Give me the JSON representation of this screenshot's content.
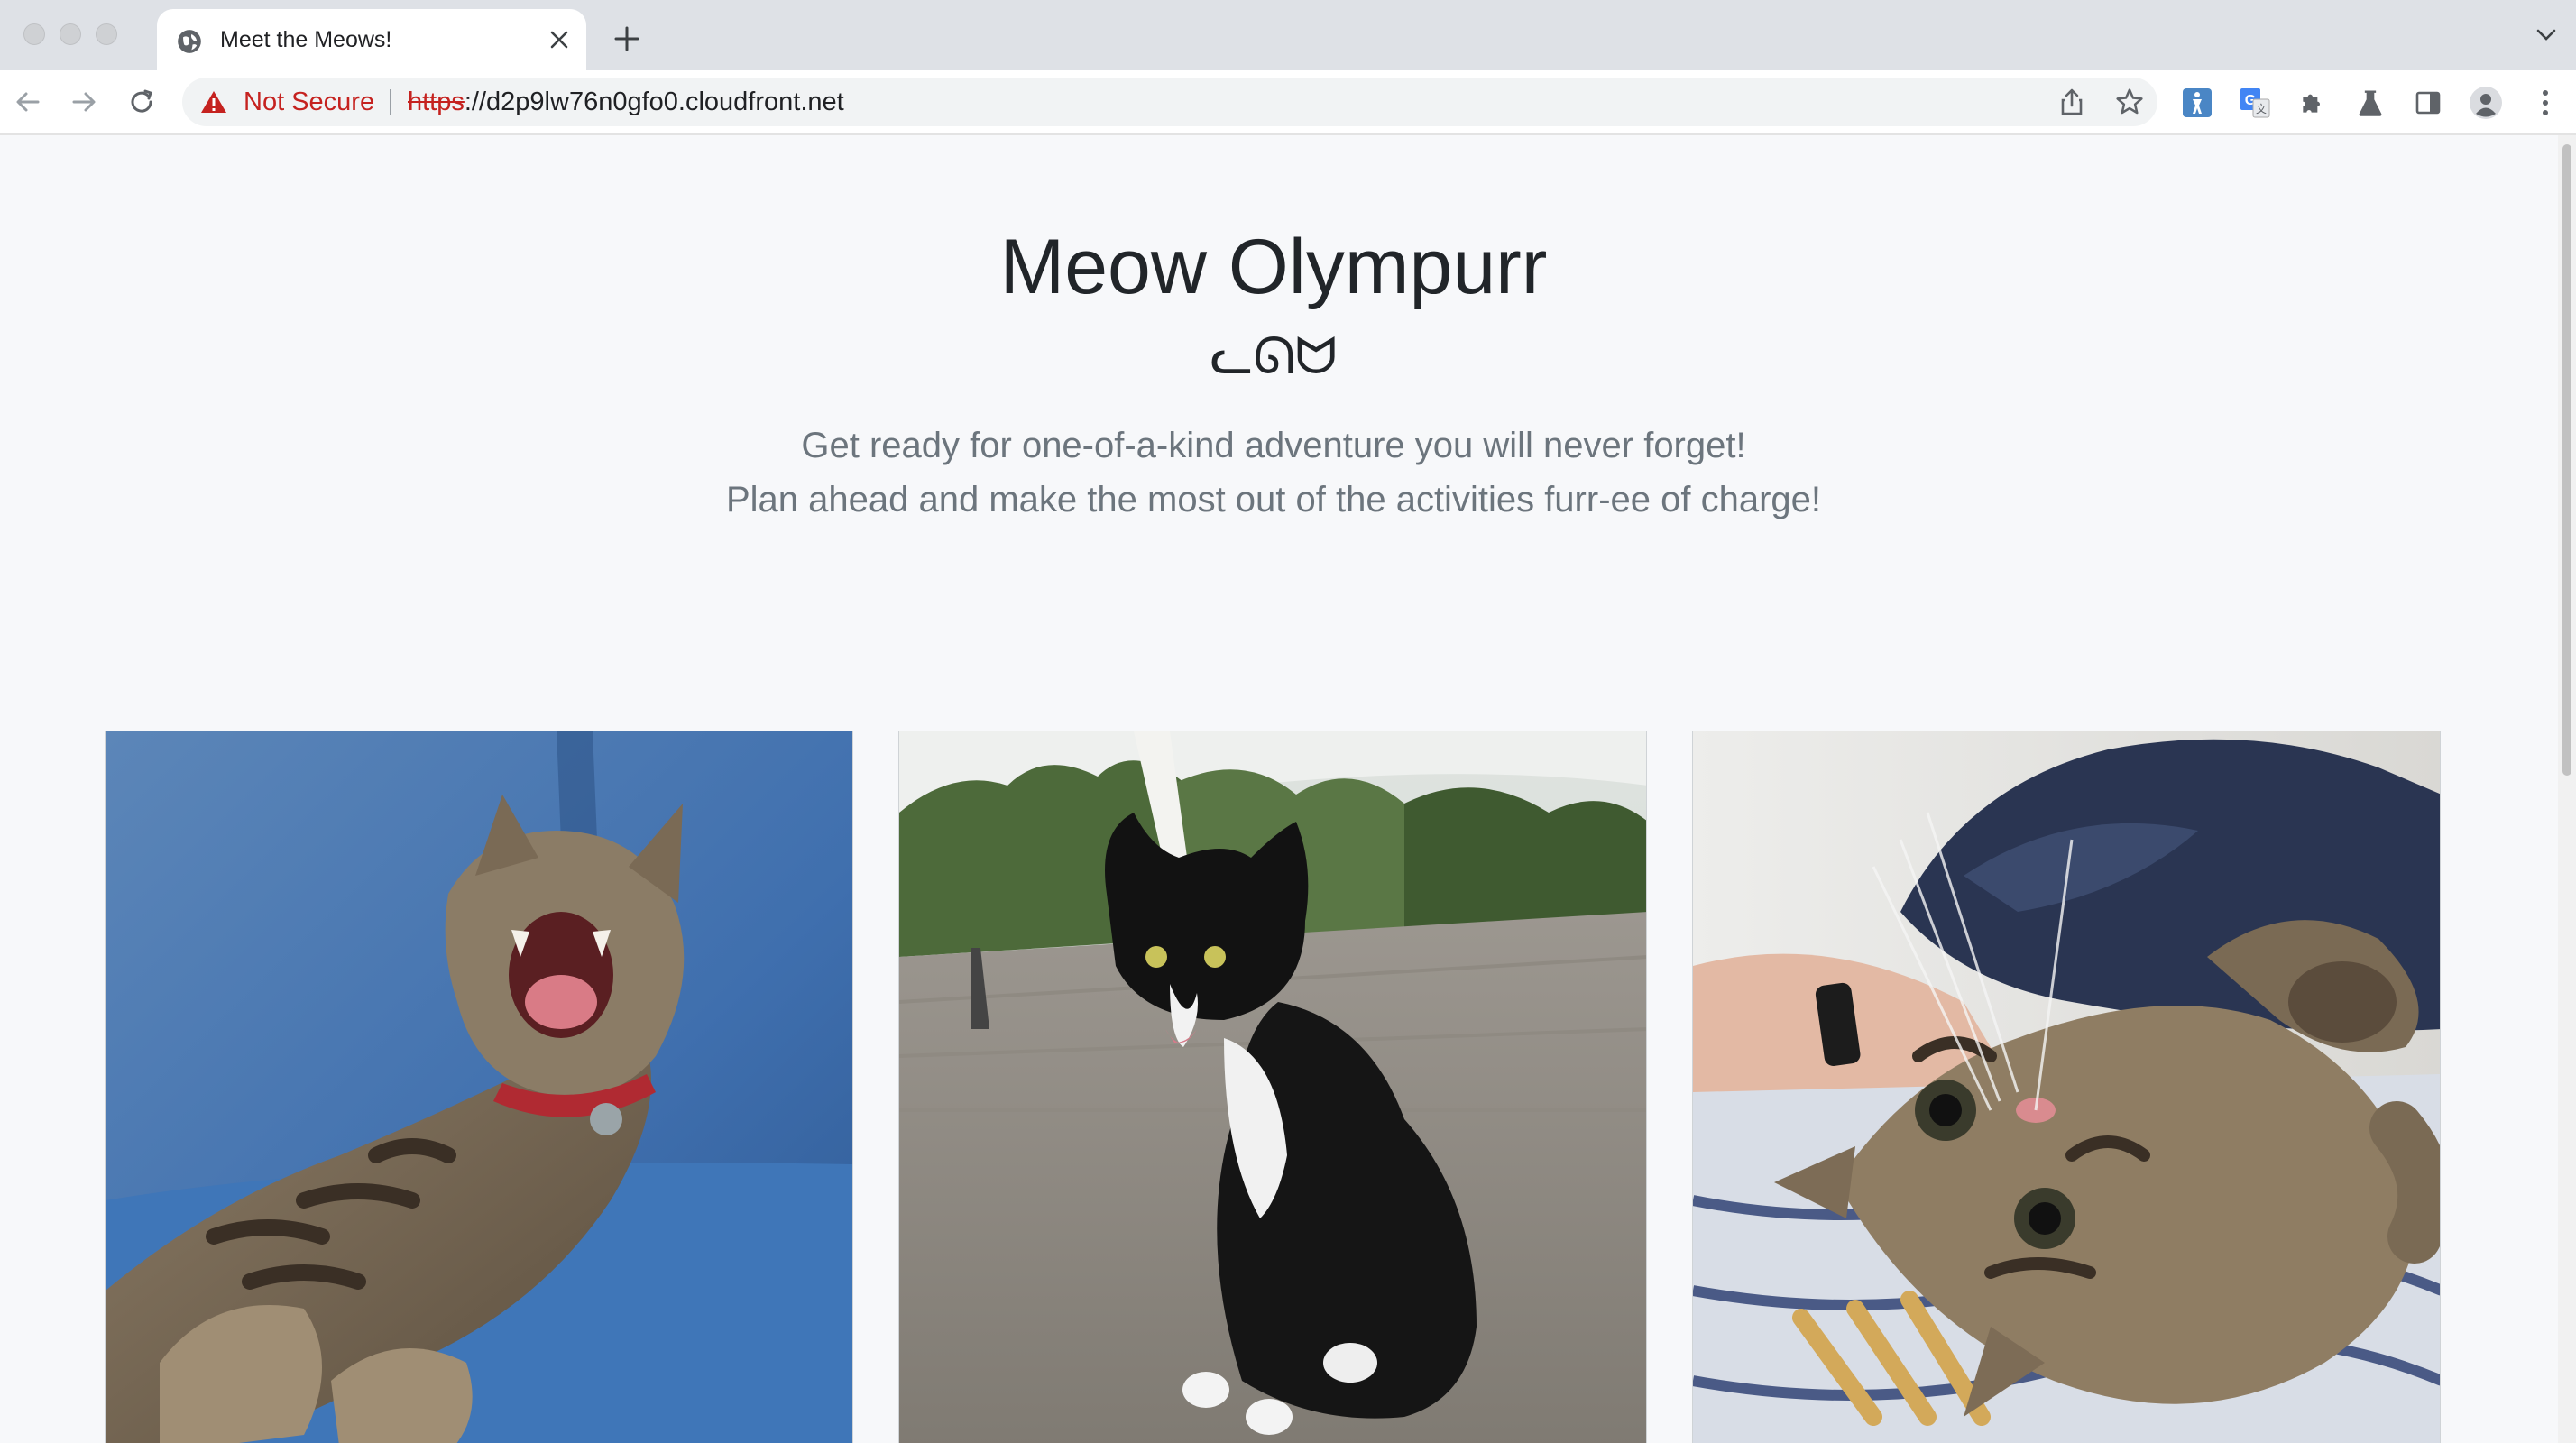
{
  "browser": {
    "tab_title": "Meet the Meows!",
    "security_label": "Not Secure",
    "url_scheme": "https",
    "url_rest": "://d2p9lw76n0gfo0.cloudfront.net"
  },
  "icons": [
    "globe-icon",
    "close-icon",
    "plus-icon",
    "chevron-down-icon",
    "back-arrow-icon",
    "forward-arrow-icon",
    "reload-icon",
    "warning-icon",
    "share-icon",
    "star-icon",
    "extension-icons",
    "translate-icon",
    "puzzle-icon",
    "flask-icon",
    "sidepanel-icon",
    "profile-icon",
    "kebab-menu-icon"
  ],
  "hero": {
    "title": "Meow Olympurr",
    "emoticon": "ᓚᘏᗢ",
    "lead_line1": "Get ready for one-of-a-kind adventure you will never forget!",
    "lead_line2": "Plan ahead and make the most out of the activities furr-ee of charge!"
  },
  "cards": [
    {
      "subject": "tabby-cat-yawning"
    },
    {
      "subject": "tuxedo-cat-sitting"
    },
    {
      "subject": "tabby-cat-lying-upside-down"
    }
  ],
  "colors": {
    "warning": "#c5221f",
    "page_bg": "#f7f8fa",
    "heading": "#212529",
    "muted": "#6c757d"
  }
}
